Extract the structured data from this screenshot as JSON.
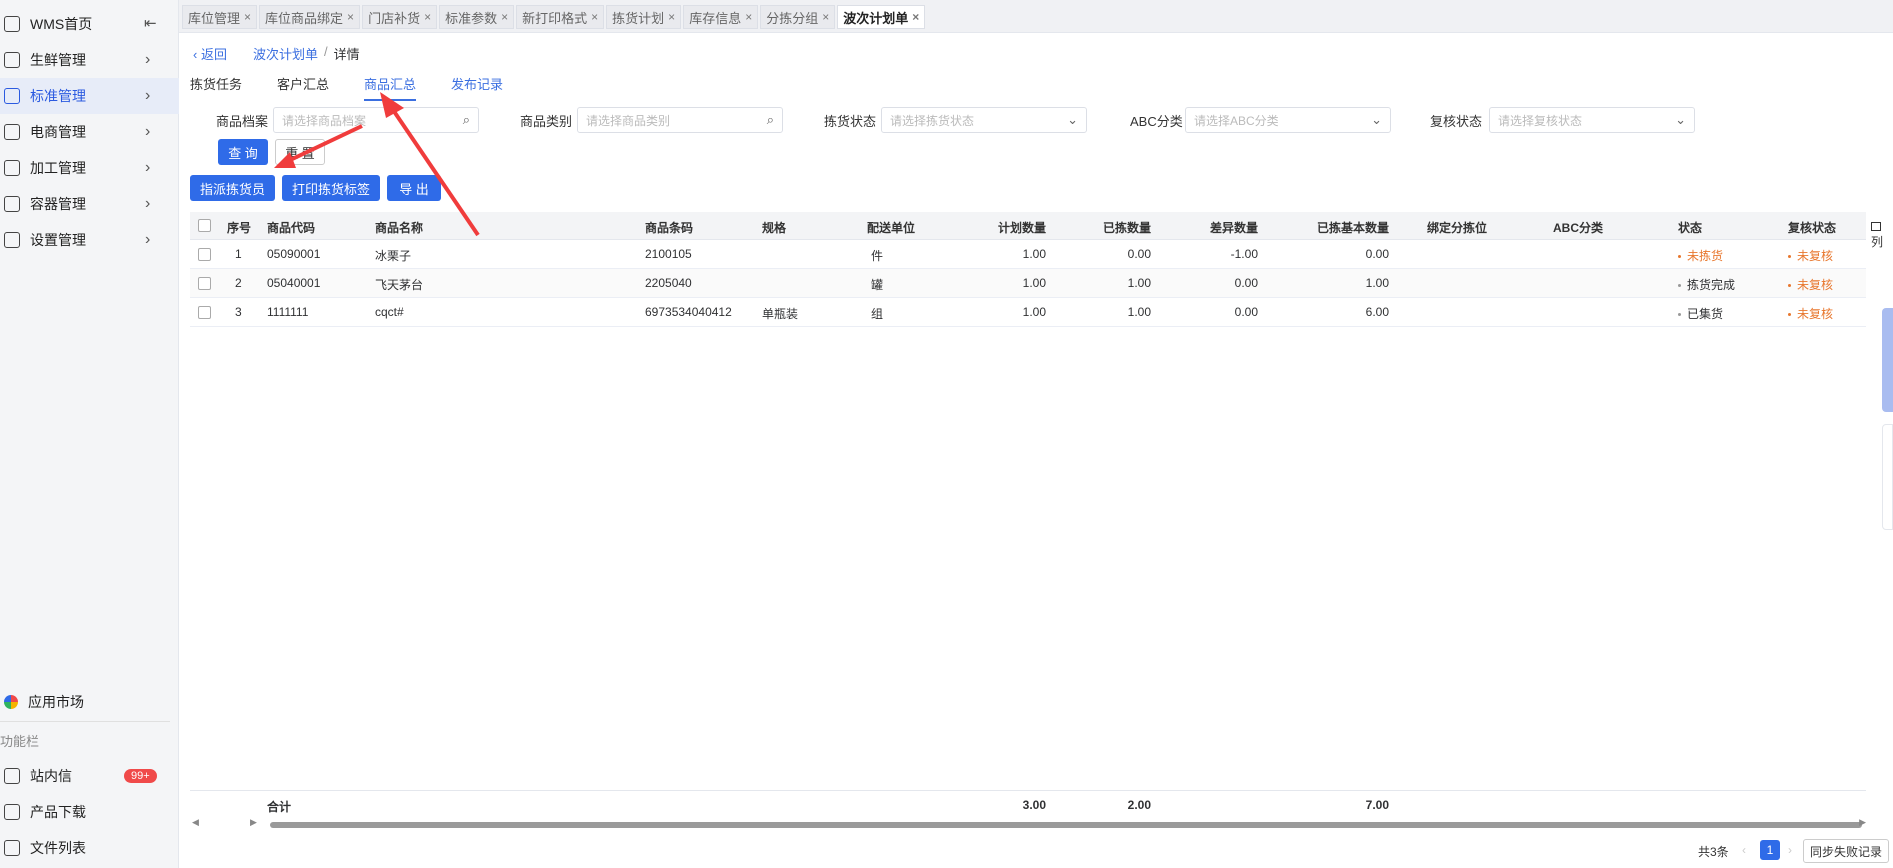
{
  "sidebar": {
    "collapse_glyph": "⇤",
    "items": [
      {
        "label": "WMS首页",
        "icon": "home-icon",
        "chevron": false,
        "active": false
      },
      {
        "label": "生鲜管理",
        "icon": "fresh-icon",
        "chevron": true,
        "active": false
      },
      {
        "label": "标准管理",
        "icon": "standard-icon",
        "chevron": true,
        "active": true
      },
      {
        "label": "电商管理",
        "icon": "ecommerce-icon",
        "chevron": true,
        "active": false
      },
      {
        "label": "加工管理",
        "icon": "processing-icon",
        "chevron": true,
        "active": false
      },
      {
        "label": "容器管理",
        "icon": "container-icon",
        "chevron": true,
        "active": false
      },
      {
        "label": "设置管理",
        "icon": "settings-icon",
        "chevron": true,
        "active": false
      }
    ],
    "app_market": "应用市场",
    "group_label": "功能栏",
    "messages": "站内信",
    "messages_badge": "99+",
    "downloads": "产品下载",
    "files": "文件列表"
  },
  "tabs": [
    "库位管理",
    "库位商品绑定",
    "门店补货",
    "标准参数",
    "新打印格式",
    "拣货计划",
    "库存信息",
    "分拣分组",
    "波次计划单"
  ],
  "active_tab": "波次计划单",
  "breadcrumb": {
    "back": "返回",
    "parent": "波次计划单",
    "sep": "/",
    "current": "详情"
  },
  "subtabs": [
    "拣货任务",
    "客户汇总",
    "商品汇总",
    "发布记录"
  ],
  "active_subtab": "商品汇总",
  "filters": [
    {
      "label": "商品档案",
      "placeholder": "请选择商品档案",
      "suffix": "search"
    },
    {
      "label": "商品类别",
      "placeholder": "请选择商品类别",
      "suffix": "search"
    },
    {
      "label": "拣货状态",
      "placeholder": "请选择拣货状态",
      "suffix": "chevron"
    },
    {
      "label": "ABC分类",
      "placeholder": "请选择ABC分类",
      "suffix": "chevron"
    },
    {
      "label": "复核状态",
      "placeholder": "请选择复核状态",
      "suffix": "chevron"
    }
  ],
  "buttons": {
    "query": "查 询",
    "reset": "重 置",
    "assign": "指派拣货员",
    "print": "打印拣货标签",
    "export": "导 出"
  },
  "table": {
    "columns": [
      "序号",
      "商品代码",
      "商品名称",
      "商品条码",
      "规格",
      "配送单位",
      "计划数量",
      "已拣数量",
      "差异数量",
      "已拣基本数量",
      "绑定分拣位",
      "ABC分类",
      "状态",
      "复核状态"
    ],
    "rows": [
      {
        "seq": "1",
        "code": "05090001",
        "name": "冰栗子",
        "barcode": "2100105",
        "spec": "",
        "unit": "件",
        "plan": "1.00",
        "picked": "0.00",
        "diff": "-1.00",
        "picked_base": "0.00",
        "bin": "",
        "abc": "",
        "status": "未拣货",
        "review": "未复核"
      },
      {
        "seq": "2",
        "code": "05040001",
        "name": "飞天茅台",
        "barcode": "2205040",
        "spec": "",
        "unit": "罐",
        "plan": "1.00",
        "picked": "1.00",
        "diff": "0.00",
        "picked_base": "1.00",
        "bin": "",
        "abc": "",
        "status": "拣货完成",
        "review": "未复核"
      },
      {
        "seq": "3",
        "code": "1111111",
        "name": "cqct#",
        "barcode": "6973534040412",
        "spec": "单瓶装",
        "unit": "组",
        "plan": "1.00",
        "picked": "1.00",
        "diff": "0.00",
        "picked_base": "6.00",
        "bin": "",
        "abc": "",
        "status": "已集货",
        "review": "未复核"
      }
    ],
    "summary": {
      "label": "合计",
      "plan": "3.00",
      "picked": "2.00",
      "picked_base": "7.00"
    }
  },
  "column_setting": "列",
  "pager": {
    "total": "共3条",
    "page": "1",
    "sync": "同步失败记录"
  },
  "colors": {
    "primary": "#2f6be8",
    "warn": "#e8772e",
    "arrow": "#f03c3c"
  }
}
